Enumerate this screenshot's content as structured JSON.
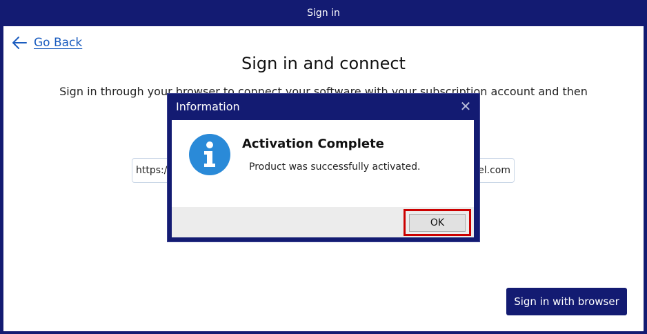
{
  "window": {
    "title": "Sign in"
  },
  "page": {
    "go_back_label": "Go Back",
    "heading": "Sign in and connect",
    "description": "Sign in through your browser to connect your software with your subscription account and then",
    "url_prefix": "https://",
    "url_suffix": "bel.com",
    "signin_browser_label": "Sign in with browser"
  },
  "dialog": {
    "title": "Information",
    "heading": "Activation Complete",
    "message": "Product was successfully activated.",
    "ok_label": "OK",
    "icon": "info-icon"
  },
  "colors": {
    "brand_navy": "#131b72",
    "link_blue": "#1a5cbf",
    "info_blue": "#2a8ad8",
    "highlight_red": "#cc0000"
  }
}
